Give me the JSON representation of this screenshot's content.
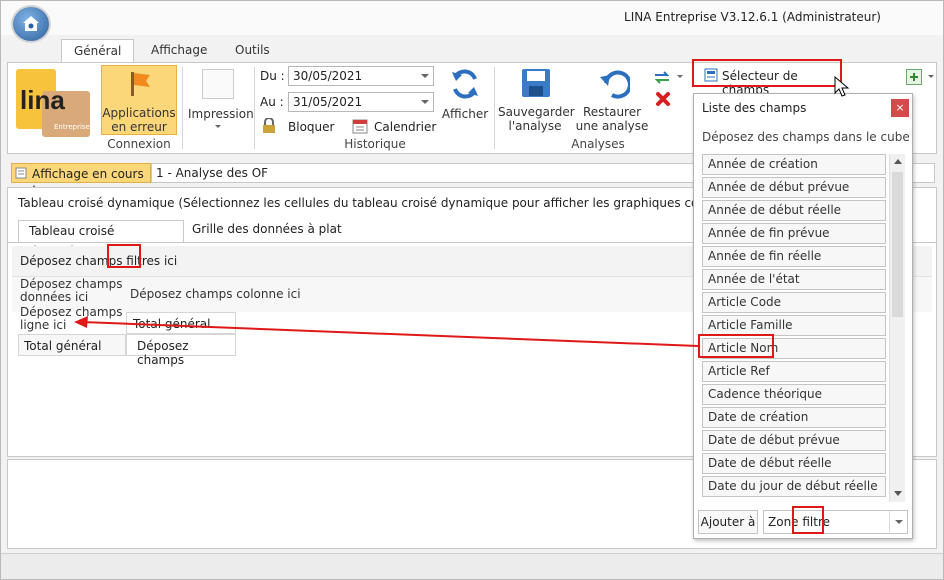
{
  "window": {
    "title": "LINA Entreprise  V3.12.6.1  (Administrateur)"
  },
  "tabs": [
    "Général",
    "Affichage",
    "Outils"
  ],
  "ribbon": {
    "logo_text": "lina",
    "logo_sub": "Entreprise",
    "connexion": {
      "button_line1": "Applications",
      "button_line2": "en erreur",
      "group": "Connexion"
    },
    "impression": {
      "label": "Impression"
    },
    "historique": {
      "du_label": "Du :",
      "du_value": "30/05/2021",
      "au_label": "Au :",
      "au_value": "31/05/2021",
      "bloquer": "Bloquer",
      "calendrier": "Calendrier",
      "afficher": "Afficher",
      "group": "Historique"
    },
    "analyses": {
      "sauvegarder_l1": "Sauvegarder",
      "sauvegarder_l2": "l'analyse",
      "restaurer_l1": "Restaurer",
      "restaurer_l2": "une analyse",
      "group": "Analyses"
    },
    "selecteur": "Sélecteur de champs"
  },
  "status": {
    "label": "Affichage en cours :",
    "value": "1 - Analyse des OF"
  },
  "main": {
    "description": "Tableau croisé dynamique (Sélectionnez les cellules du tableau croisé dynamique pour afficher les graphiques correspondants)",
    "tabs": [
      "Tableau croisé dynamique",
      "Grille des données à plat"
    ],
    "filter_drop": "Déposez champs filtres ici",
    "data_drop_l1": "Déposez champs",
    "data_drop_l2": "données ici",
    "column_drop": "Déposez champs colonne ici",
    "row_drop_l1": "Déposez champs",
    "row_drop_l2": "ligne ici",
    "total_col": "Total général",
    "total_row": "Total général",
    "drop_cell": "Déposez champs"
  },
  "fieldlist": {
    "title": "Liste des champs",
    "subtitle": "Déposez des champs dans le cube",
    "items": [
      "Année de création",
      "Année de début prévue",
      "Année de début réelle",
      "Année de fin prévue",
      "Année de fin réelle",
      "Année de l'état",
      "Article Code",
      "Article Famille",
      "Article Nom",
      "Article Ref",
      "Cadence théorique",
      "Date de création",
      "Date de début prévue",
      "Date de début réelle",
      "Date du jour de début réelle"
    ],
    "add_button": "Ajouter à",
    "zone_value": "Zone filtre"
  },
  "colors": {
    "highlight": "#e01818",
    "accent": "#f7c33d",
    "selected_btn": "#fbd77a"
  }
}
